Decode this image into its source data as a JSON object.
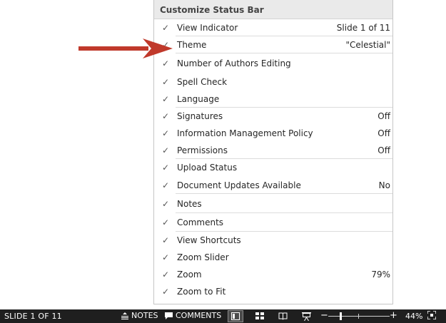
{
  "menu": {
    "title": "Customize Status Bar",
    "items": [
      {
        "label": "View Indicator",
        "value": "Slide 1 of 11",
        "checked": "✓"
      },
      {
        "label": "Theme",
        "value": "\"Celestial\"",
        "checked": "✓"
      },
      {
        "label": "Number of Authors Editing",
        "value": "",
        "checked": "✓"
      },
      {
        "label": "Spell Check",
        "value": "",
        "checked": "✓"
      },
      {
        "label": "Language",
        "value": "",
        "checked": "✓"
      },
      {
        "label": "Signatures",
        "value": "Off",
        "checked": "✓"
      },
      {
        "label": "Information Management Policy",
        "value": "Off",
        "checked": "✓"
      },
      {
        "label": "Permissions",
        "value": "Off",
        "checked": "✓"
      },
      {
        "label": "Upload Status",
        "value": "",
        "checked": "✓"
      },
      {
        "label": "Document Updates Available",
        "value": "No",
        "checked": "✓"
      },
      {
        "label": "Notes",
        "value": "",
        "checked": "✓"
      },
      {
        "label": "Comments",
        "value": "",
        "checked": "✓"
      },
      {
        "label": "View Shortcuts",
        "value": "",
        "checked": "✓"
      },
      {
        "label": "Zoom Slider",
        "value": "",
        "checked": "✓"
      },
      {
        "label": "Zoom",
        "value": "79%",
        "checked": "✓"
      },
      {
        "label": "Zoom to Fit",
        "value": "",
        "checked": "✓"
      }
    ]
  },
  "annotation": {
    "arrow_color": "#c0392b",
    "icon": "right-arrow-icon"
  },
  "statusbar": {
    "slide_indicator": "SLIDE 1 OF 11",
    "notes_label": "NOTES",
    "comments_label": "COMMENTS",
    "zoom_level": "44%",
    "zoom_fraction": 0.44,
    "background": "#1f1f1f"
  }
}
